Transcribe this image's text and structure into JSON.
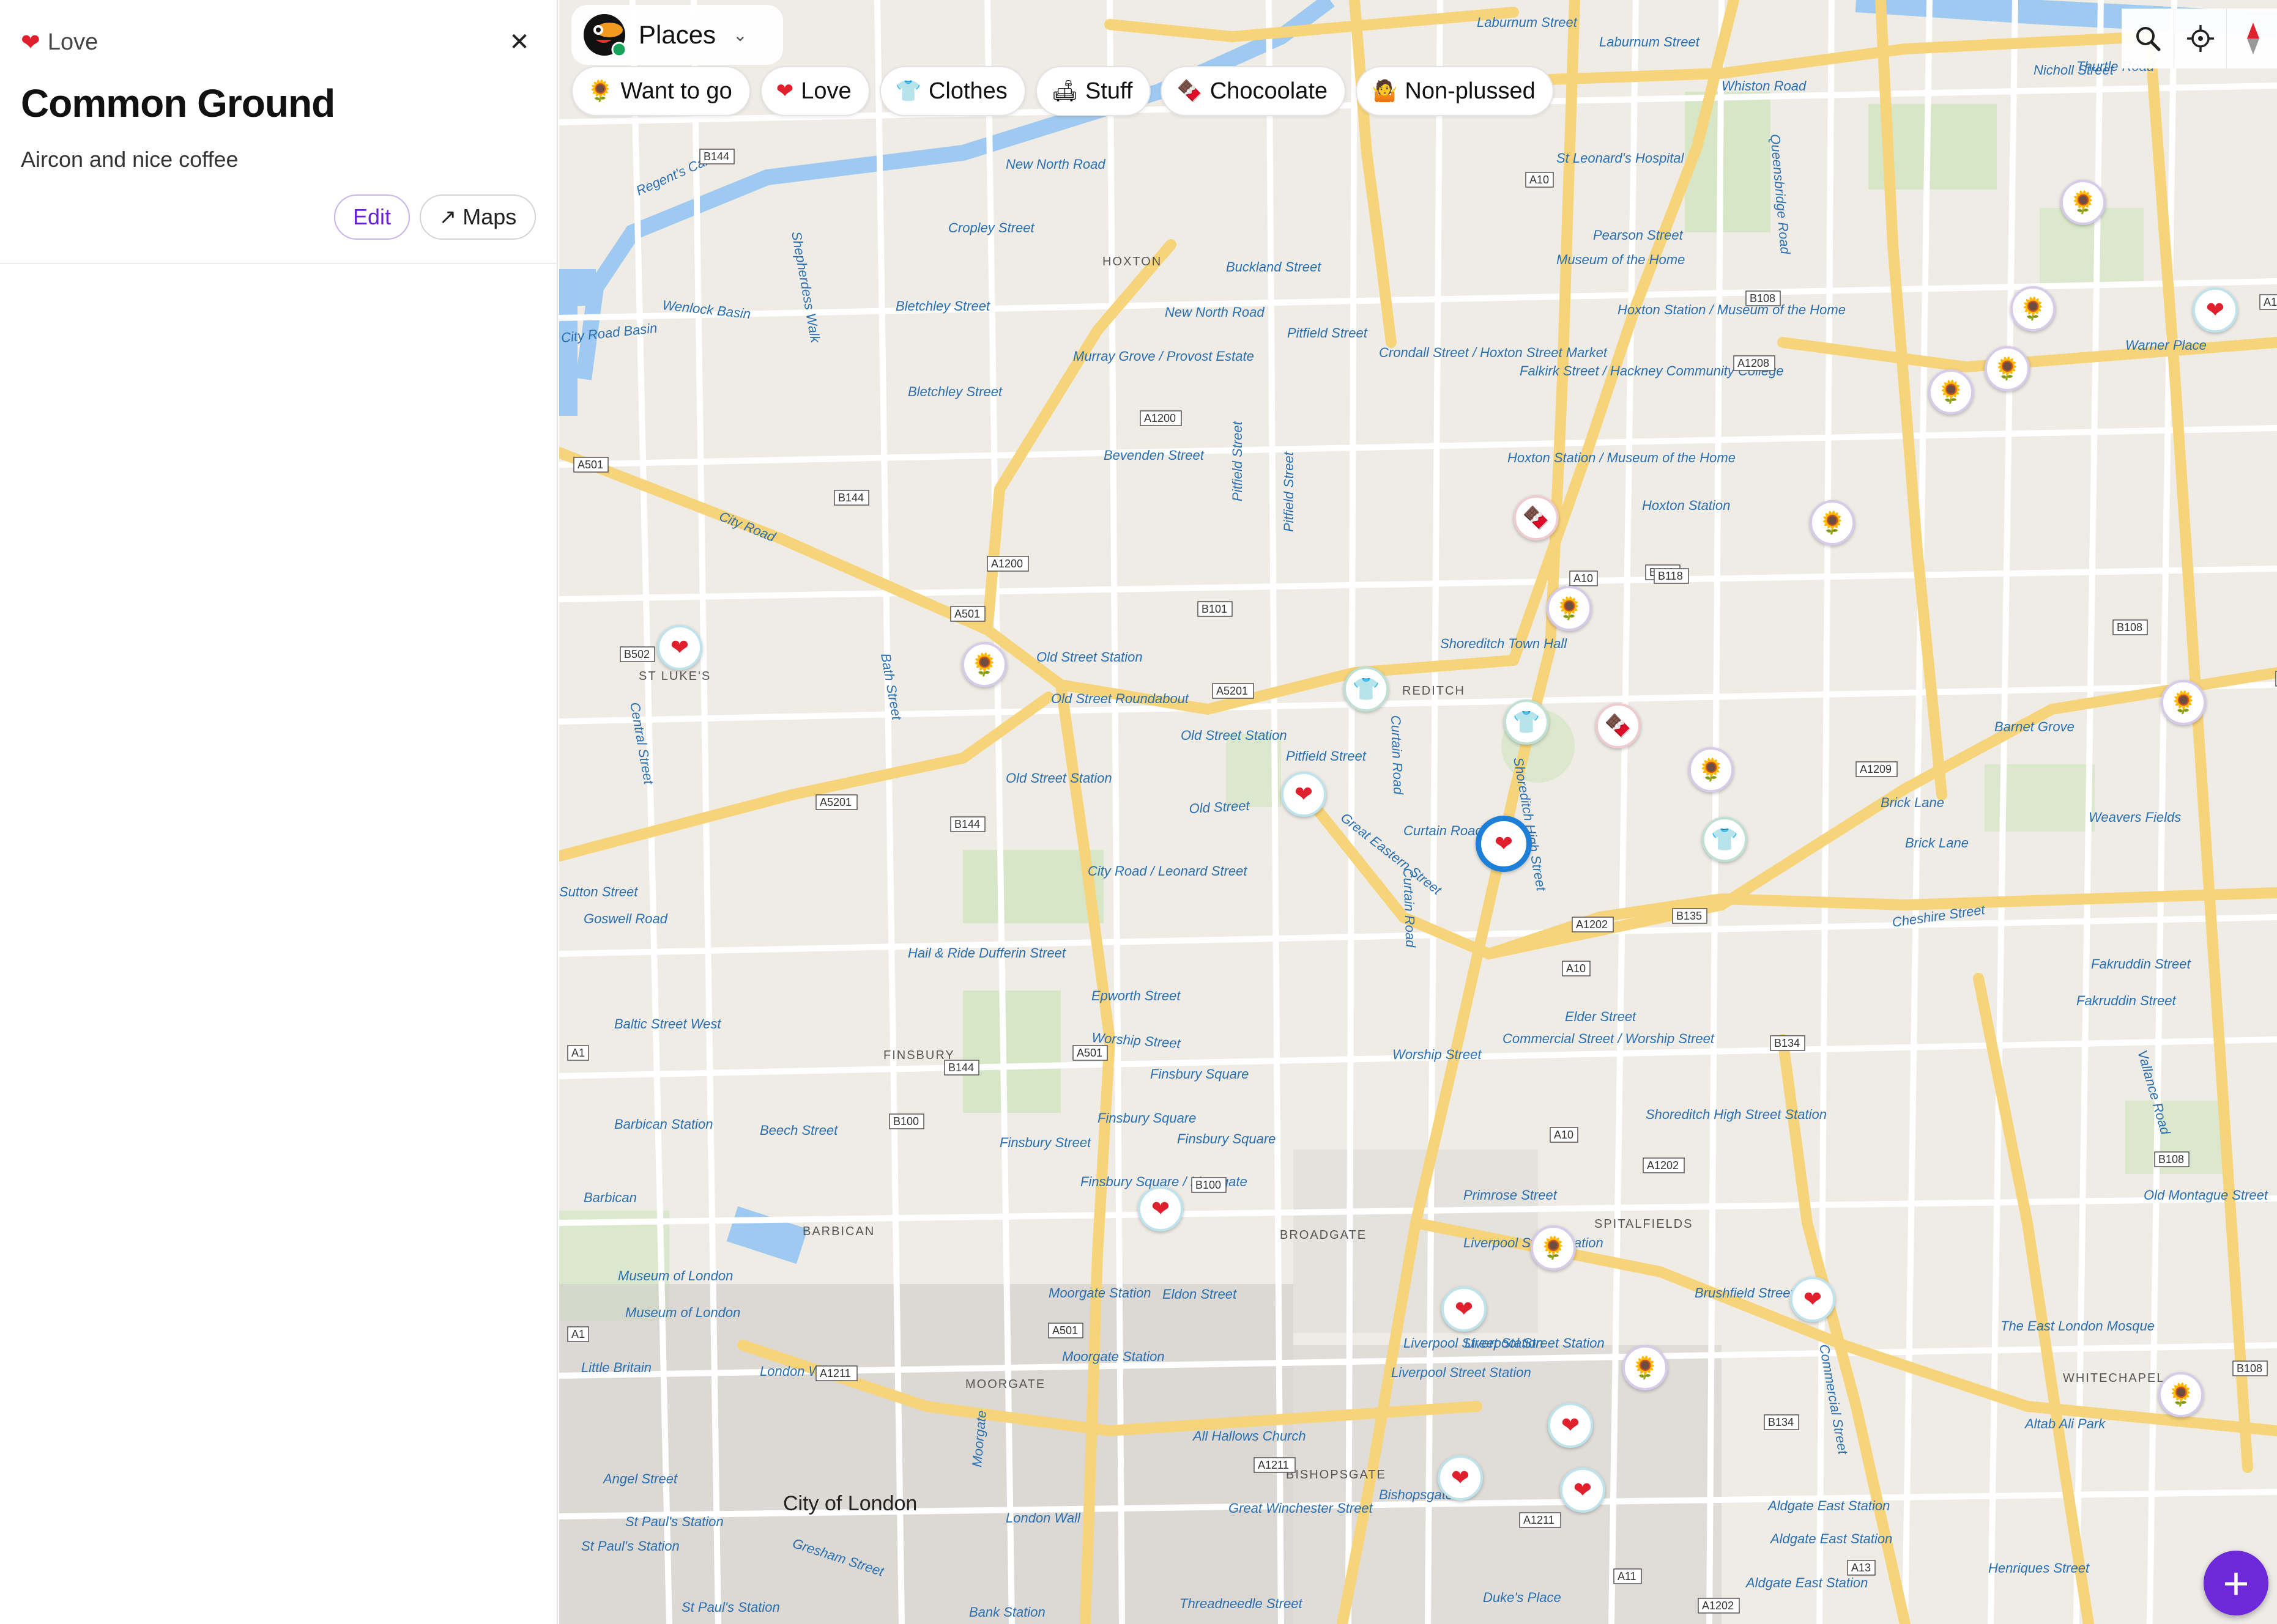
{
  "panel": {
    "category": {
      "icon": "heart-icon",
      "emoji": "❤",
      "label": "Love"
    },
    "close_icon": "close-icon",
    "close_glyph": "✕",
    "title": "Common Ground",
    "note": "Aircon and nice coffee",
    "edit_label": "Edit",
    "maps_arrow": "↗",
    "maps_label": "Maps"
  },
  "topbar": {
    "logo_icon": "toucan-logo-icon",
    "title": "Places",
    "dropdown_glyph": "⌄"
  },
  "filters": [
    {
      "icon": "sunflower-icon",
      "emoji": "🌻",
      "label": "Want to go"
    },
    {
      "icon": "heart-icon",
      "emoji": "❤",
      "label": "Love"
    },
    {
      "icon": "shirt-icon",
      "emoji": "👕",
      "label": "Clothes"
    },
    {
      "icon": "sofa-icon",
      "emoji": "🛋",
      "label": "Stuff"
    },
    {
      "icon": "chocolate-icon",
      "emoji": "🍫",
      "label": "Chocoolate"
    },
    {
      "icon": "shrug-icon",
      "emoji": "🤷",
      "label": "Non-plussed"
    }
  ],
  "controls": [
    {
      "icon": "search-icon"
    },
    {
      "icon": "locate-icon"
    },
    {
      "icon": "compass-icon"
    }
  ],
  "fab": {
    "icon": "plus-icon",
    "glyph": "+"
  },
  "map": {
    "city_label": "City of London",
    "districts": [
      "HOXTON",
      "FINSBURY",
      "BARBICAN",
      "BROADGATE",
      "SPITALFIELDS",
      "WHITECHAPEL",
      "MOORGATE",
      "BISHOPSGATE",
      "ST LUKE'S",
      "REDITCH"
    ],
    "streets": [
      "Laburnum Street",
      "Laburnum Street",
      "Whiston Road",
      "Thurtle Road",
      "Nicholl Street",
      "New North Road",
      "St Leonard's Hospital",
      "Cropley Street",
      "Pearson Street",
      "Museum of the Home",
      "Buckland Street",
      "Queensbridge Road",
      "Bletchley Street",
      "New North Road",
      "Hoxton Station / Museum of the Home",
      "Pitfield Street",
      "Murray Grove / Provost Estate",
      "Crondall Street / Hoxton Street Market",
      "Falkirk Street / Hackney Community College",
      "Warner Place",
      "Bletchley Street",
      "Bevenden Street",
      "Hoxton Station / Museum of the Home",
      "Hoxton Station",
      "City Road",
      "Pitfield Street",
      "Old Street Station",
      "Old Street Roundabout",
      "Shoreditch Town Hall",
      "Barnet Grove",
      "Old Street Station",
      "Pitfield Street",
      "Old Street Station",
      "Curtain Road",
      "Brick Lane",
      "Brick Lane",
      "Weavers Fields",
      "Curtain Road",
      "Great Eastern Street",
      "Cheshire Street",
      "City Road / Leonard Street",
      "Goswell Road",
      "Hail & Ride Dufferin Street",
      "Fakruddin Street",
      "Fakruddin Street",
      "Epworth Street",
      "Elder Street",
      "Worship Street",
      "Commercial Street / Worship Street",
      "Worship Street",
      "Baltic Street West",
      "Finsbury Square",
      "Shoreditch High Street Station",
      "Finsbury Square",
      "Barbican Station",
      "Beech Street",
      "Finsbury Square",
      "Finsbury Street",
      "Old Montague Street",
      "Finsbury Square / Moorgate",
      "Primrose Street",
      "Barbican",
      "Liverpool Street Station",
      "Museum of London",
      "Moorgate Station",
      "Eldon Street",
      "Brushfield Street",
      "Museum of London",
      "Liverpool Street Station",
      "The East London Mosque",
      "Moorgate Station",
      "Liverpool Street Station",
      "Little Britain",
      "London Wall",
      "Liverpool Street Station",
      "Altab Ali Park",
      "All Hallows Church",
      "Angel Street",
      "Great Winchester Street",
      "Bishopsgate",
      "St Paul's Station",
      "London Wall",
      "Aldgate East Station",
      "Aldgate East Station",
      "St Paul's Station",
      "Henriques Street",
      "Aldgate East Station",
      "Gresham Street",
      "Threadneedle Street",
      "Duke's Place",
      "St Paul's Station",
      "Bank Station",
      "Wenlock Basin",
      "City Road Basin",
      "Regent's Canal",
      "Shepherdess Walk",
      "Bath Street",
      "Central Street",
      "Pitfield Street",
      "Curtain Road",
      "Shoreditch High Street",
      "Commercial Street",
      "Vallance Road",
      "Sutton Street",
      "Moorgate",
      "Old Street"
    ],
    "road_numbers": [
      "A10",
      "A1208",
      "B108",
      "A1208",
      "B144",
      "A501",
      "A1200",
      "B144",
      "A1200",
      "B101",
      "A10",
      "B118",
      "B108",
      "A501",
      "A5201",
      "B502",
      "A5201",
      "B144",
      "A1209",
      "A1202",
      "B135",
      "A10",
      "B134",
      "A501",
      "B144",
      "A1",
      "B100",
      "A10",
      "A1202",
      "B100",
      "B108",
      "A501",
      "A1211",
      "A1",
      "B134",
      "B108",
      "A1211",
      "A1211",
      "A11",
      "A13",
      "A1202",
      "B118",
      "A1209"
    ],
    "pins": [
      {
        "kind": "want",
        "icon": "sunflower-icon",
        "emoji": "🌻"
      },
      {
        "kind": "want",
        "icon": "sunflower-icon",
        "emoji": "🌻"
      },
      {
        "kind": "love",
        "icon": "heart-icon",
        "emoji": "❤"
      },
      {
        "kind": "want",
        "icon": "sunflower-icon",
        "emoji": "🌻"
      },
      {
        "kind": "want",
        "icon": "sunflower-icon",
        "emoji": "🌻"
      },
      {
        "kind": "choc",
        "icon": "chocolate-icon",
        "emoji": "🍫"
      },
      {
        "kind": "want",
        "icon": "sunflower-icon",
        "emoji": "🌻"
      },
      {
        "kind": "want",
        "icon": "sunflower-icon",
        "emoji": "🌻"
      },
      {
        "kind": "love",
        "icon": "heart-icon",
        "emoji": "❤"
      },
      {
        "kind": "want",
        "icon": "sunflower-icon",
        "emoji": "🌻"
      },
      {
        "kind": "clothes",
        "icon": "shirt-icon",
        "emoji": "👕"
      },
      {
        "kind": "clothes",
        "icon": "shirt-icon",
        "emoji": "👕"
      },
      {
        "kind": "choc",
        "icon": "chocolate-icon",
        "emoji": "🍫"
      },
      {
        "kind": "want",
        "icon": "sunflower-icon",
        "emoji": "🌻"
      },
      {
        "kind": "want",
        "icon": "sunflower-icon",
        "emoji": "🌻"
      },
      {
        "kind": "love",
        "icon": "heart-icon",
        "emoji": "❤"
      },
      {
        "kind": "clothes",
        "icon": "shirt-icon",
        "emoji": "👕"
      },
      {
        "kind": "love",
        "icon": "heart-icon",
        "emoji": "❤",
        "selected": true
      },
      {
        "kind": "love",
        "icon": "heart-icon",
        "emoji": "❤"
      },
      {
        "kind": "want",
        "icon": "sunflower-icon",
        "emoji": "🌻"
      },
      {
        "kind": "love",
        "icon": "heart-icon",
        "emoji": "❤"
      },
      {
        "kind": "love",
        "icon": "heart-icon",
        "emoji": "❤"
      },
      {
        "kind": "want",
        "icon": "sunflower-icon",
        "emoji": "🌻"
      },
      {
        "kind": "want",
        "icon": "sunflower-icon",
        "emoji": "🌻"
      },
      {
        "kind": "love",
        "icon": "heart-icon",
        "emoji": "❤"
      },
      {
        "kind": "love",
        "icon": "heart-icon",
        "emoji": "❤"
      },
      {
        "kind": "love",
        "icon": "heart-icon",
        "emoji": "❤"
      }
    ]
  },
  "colors": {
    "accent": "#6d28d9",
    "heart": "#e0202c",
    "selected_ring": "#1e7fd8",
    "major_road": "#f7d37a",
    "water": "#9ec9f0"
  }
}
